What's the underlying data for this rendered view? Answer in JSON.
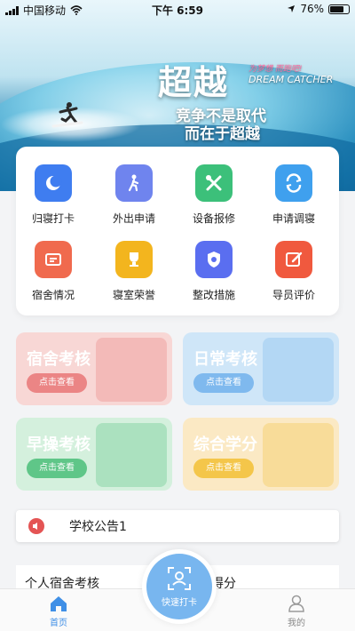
{
  "status": {
    "carrier": "中国移动",
    "time": "下午 6:59",
    "battery": "76%",
    "battery_level": 0.76
  },
  "banner": {
    "slogan_main": "超越",
    "slogan_en": "DREAM CATCHER",
    "slogan_tag": "为梦想 而跑吧!",
    "line1": "竞争不是取代",
    "line2": "而在于超越"
  },
  "grid": [
    {
      "label": "归寝打卡",
      "icon": "moon-icon",
      "color": "#3f7df0"
    },
    {
      "label": "外出申请",
      "icon": "walking-person-icon",
      "color": "#6f84ee"
    },
    {
      "label": "设备报修",
      "icon": "tools-icon",
      "color": "#3cc07a"
    },
    {
      "label": "申请调寝",
      "icon": "swap-icon",
      "color": "#3fa0ee"
    },
    {
      "label": "宿舍情况",
      "icon": "dorm-card-icon",
      "color": "#f06a4e"
    },
    {
      "label": "寝室荣誉",
      "icon": "trophy-icon",
      "color": "#f3b51e"
    },
    {
      "label": "整改措施",
      "icon": "badge-icon",
      "color": "#5a6ef0"
    },
    {
      "label": "导员评价",
      "icon": "edit-icon",
      "color": "#f0593e"
    }
  ],
  "cards": [
    {
      "title": "宿舍考核",
      "button": "点击查看",
      "bg": "#f8d7d5",
      "accent": "#eb8585"
    },
    {
      "title": "日常考核",
      "button": "点击查看",
      "bg": "#cfe6f8",
      "accent": "#7fb9ee"
    },
    {
      "title": "早操考核",
      "button": "点击查看",
      "bg": "#d4f0dd",
      "accent": "#5fc688"
    },
    {
      "title": "综合学分",
      "button": "点击查看",
      "bg": "#fbe9c4",
      "accent": "#f4c64a"
    }
  ],
  "notice": {
    "text": "学校公告1"
  },
  "bottom": {
    "left": "个人宿舍考核",
    "right": "得分"
  },
  "tabbar": {
    "home": "首页",
    "fab": "快速打卡",
    "mine": "我的"
  }
}
